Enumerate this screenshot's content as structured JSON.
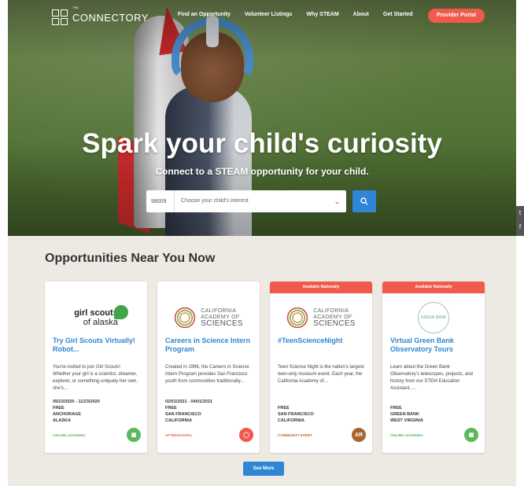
{
  "nav": {
    "logo_small": "THE",
    "logo_text": "CONNECTORY",
    "links": [
      "Find an Opportunity",
      "Volunteer Listings",
      "Why STEAM",
      "About",
      "Get Started"
    ],
    "provider_button": "Provider Portal"
  },
  "hero": {
    "title": "Spark your child's curiosity",
    "subtitle": "Connect to a STEAM opportunity for your child.",
    "zip_value": "98009",
    "interest_placeholder": "Choose your child's interest"
  },
  "social": {
    "twitter": "t",
    "facebook": "f"
  },
  "opportunities": {
    "heading": "Opportunities Near You Now",
    "see_more": "See More",
    "cards": [
      {
        "banner": "",
        "logo_main": "girl scouts",
        "logo_sub": "of alaska",
        "title": "Try Girl Scouts Virtually! Robot...",
        "description": "You're invited to join Girl Scouts! Whether your girl is a scientist, dreamer, explorer, or something uniquely her own, she's...",
        "date": "09/23/2020 - 11/23/2020",
        "price": "FREE",
        "city": "ANCHORAGE",
        "state": "ALASKA",
        "category": "ONLINE LEARNING",
        "category_color": "#5cb85c",
        "badge_color": "#5cb85c"
      },
      {
        "banner": "",
        "logo_line1": "CALIFORNIA",
        "logo_line2": "ACADEMY OF",
        "logo_line3": "SCIENCES",
        "title": "Careers in Science Intern Program",
        "description": "Created in 1996, the Careers in Science Intern Program provides San Francisco youth from communities traditionally...",
        "date": "02/01/2021 - 04/01/2021",
        "price": "FREE",
        "city": "SAN FRANCISCO",
        "state": "CALIFORNIA",
        "category": "AFTERSCHOOL",
        "category_color": "#ef5a4c",
        "badge_color": "#ef5a4c"
      },
      {
        "banner": "Available Nationally",
        "logo_line1": "CALIFORNIA",
        "logo_line2": "ACADEMY OF",
        "logo_line3": "SCIENCES",
        "title": "#TeenScienceNight",
        "description": "Teen Science Night is the nation's largest teen-only museum event. Each year, the California Academy of...",
        "date": "",
        "price": "FREE",
        "city": "SAN FRANCISCO",
        "state": "CALIFORNIA",
        "category": "COMMUNITY EVENT",
        "category_color": "#c0622e",
        "badge_color": "#a5652e",
        "badge_text": "AR"
      },
      {
        "banner": "Available Nationally",
        "logo_text": "GREEN BANK",
        "title": "Virtual Green Bank Observatory Tours",
        "description": "Learn about the Green Bank Observatory's telescopes, projects, and history from our STEM Education Assistant, ...",
        "date": "",
        "price": "FREE",
        "city": "GREEN BANK",
        "state": "WEST VIRGINIA",
        "category": "ONLINE LEARNING",
        "category_color": "#5cb85c",
        "badge_color": "#5cb85c"
      }
    ]
  }
}
